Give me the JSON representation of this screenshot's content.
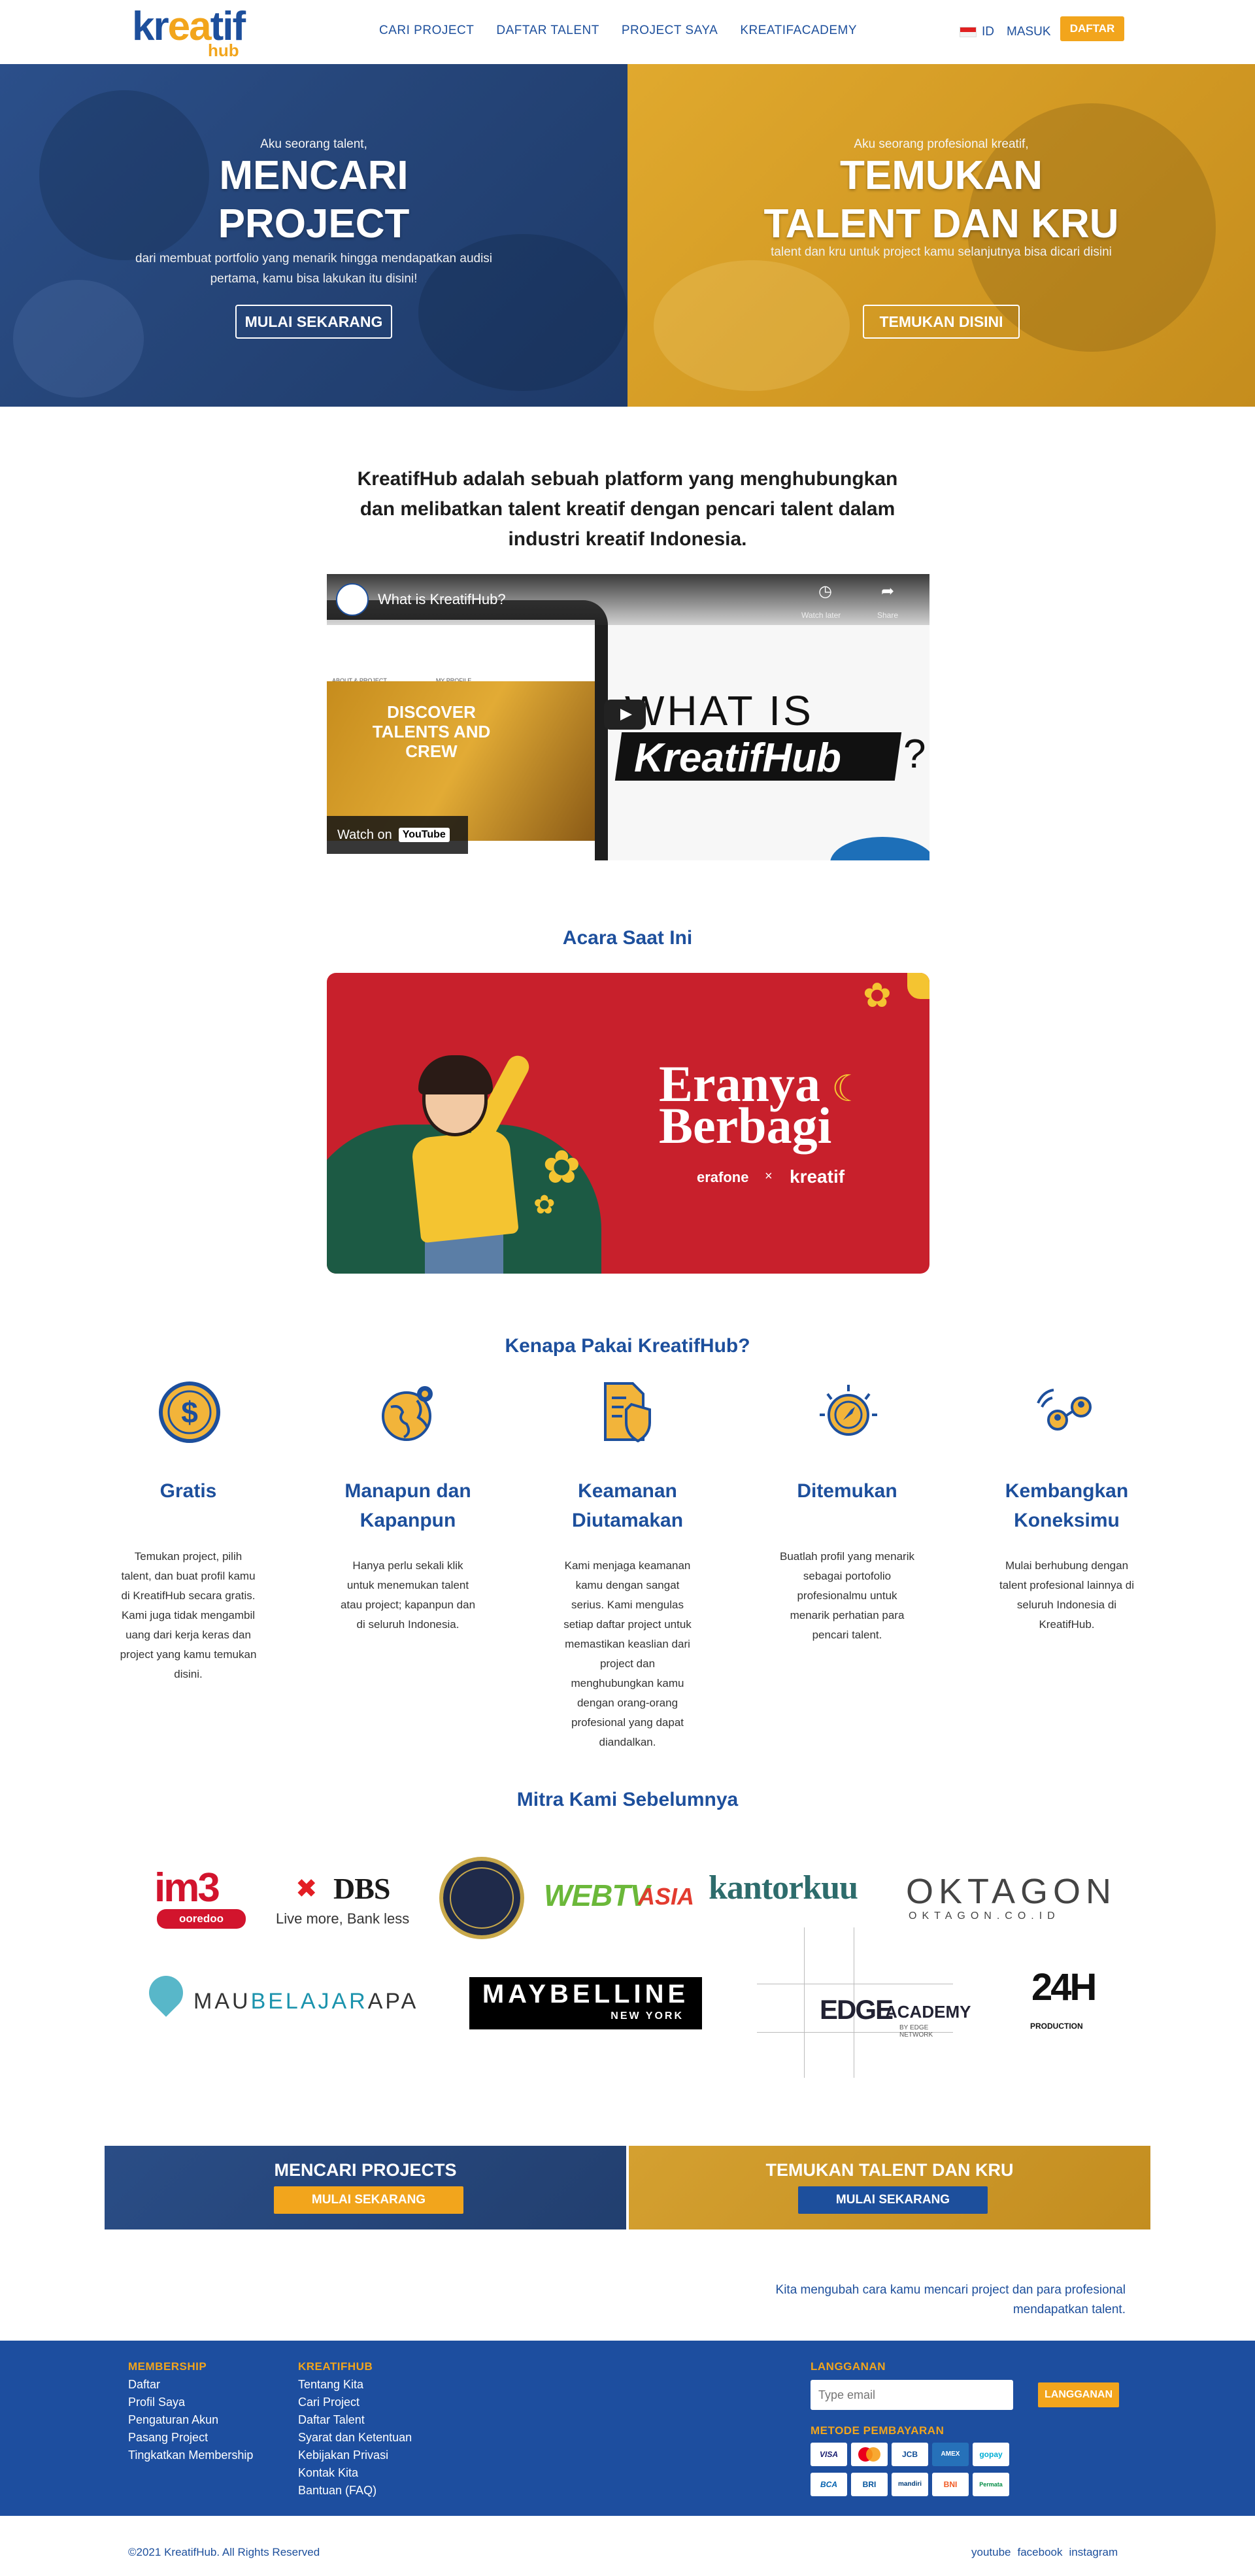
{
  "header": {
    "logo_main_a": "kr",
    "logo_main_b": "ea",
    "logo_main_c": "tif",
    "logo_sub": "hub",
    "nav": [
      "CARI PROJECT",
      "DAFTAR TALENT",
      "PROJECT SAYA",
      "KREATIFACADEMY"
    ],
    "lang": "ID",
    "login": "MASUK",
    "register": "DAFTAR"
  },
  "hero": {
    "left": {
      "pre": "Aku seorang talent,",
      "title_line1": "MENCARI",
      "title_line2": "PROJECT",
      "desc": "dari membuat portfolio yang menarik hingga mendapatkan audisi pertama, kamu bisa lakukan itu disini!",
      "button": "MULAI SEKARANG"
    },
    "right": {
      "pre": "Aku seorang profesional kreatif,",
      "title_line1": "TEMUKAN",
      "title_line2": "TALENT DAN KRU",
      "desc": "talent dan kru untuk project kamu selanjutnya bisa dicari disini",
      "button": "TEMUKAN DISINI"
    }
  },
  "about": {
    "text": "KreatifHub adalah sebuah platform yang menghubungkan dan melibatkan talent kreatif dengan pencari talent dalam industri kreatif Indonesia."
  },
  "video": {
    "title": "What is KreatifHub?",
    "watch_later": "Watch later",
    "share": "Share",
    "watch_on": "Watch on",
    "youtube": "YouTube",
    "headline": "WHAT IS",
    "brand": "KreatifHub",
    "question": "?",
    "tablet_title": "DISCOVER TALENTS AND CREW",
    "tablet_nav": "ABOUT & PROJECT",
    "tablet_menu": "MY PROFILE"
  },
  "events": {
    "heading": "Acara Saat Ini",
    "banner_line1": "Eranya",
    "banner_line2": "Berbagi",
    "partner_a": "erafone",
    "partner_cross": "×",
    "partner_b": "kreatif"
  },
  "why": {
    "heading": "Kenapa Pakai KreatifHub?",
    "items": [
      {
        "icon": "dollar-coin-icon",
        "title": "Gratis",
        "desc": "Temukan project, pilih talent, dan buat profil kamu di KreatifHub secara gratis. Kami juga tidak mengambil uang dari kerja keras dan project yang kamu temukan disini."
      },
      {
        "icon": "globe-location-icon",
        "title": "Manapun dan Kapanpun",
        "desc": "Hanya perlu sekali klik untuk menemukan talent atau project; kapanpun dan di seluruh Indonesia."
      },
      {
        "icon": "secure-document-icon",
        "title": "Keamanan Diutamakan",
        "desc": "Kami menjaga keamanan kamu dengan sangat serius. Kami mengulas setiap daftar project untuk memastikan keaslian dari project dan menghubungkan kamu dengan orang-orang profesional yang dapat diandalkan."
      },
      {
        "icon": "compass-icon",
        "title": "Ditemukan",
        "desc": "Buatlah profil yang menarik sebagai portofolio profesionalmu untuk menarik perhatian para pencari talent."
      },
      {
        "icon": "network-icon",
        "title": "Kembangkan Koneksimu",
        "desc": "Mulai berhubung dengan talent profesional lainnya di seluruh Indonesia di KreatifHub."
      }
    ]
  },
  "partners": {
    "heading": "Mitra Kami Sebelumnya",
    "im3": "im3",
    "im3_sub": "ooredoo",
    "dbs": "DBS",
    "dbs_mark": "✖",
    "dbs_sub": "Live more, Bank less",
    "webtv_a": "WEBTV",
    "webtv_b": "ASIA",
    "kantorkuu": "kantorkuu",
    "oktagon": "OKTAGON",
    "oktagon_sub": "OKTAGON.CO.ID",
    "mau_a": "MAU",
    "mau_b": "BELAJAR",
    "mau_c": "APA",
    "maybelline": "MAYBELLINE",
    "maybelline_sub": "NEW YORK",
    "edge_a": "EDGE",
    "edge_b": "ACADEMY",
    "edge_sub": "BY EDGE NETWORK",
    "h24": "24H",
    "h24_sub": "PRODUCTION"
  },
  "cta": {
    "left_title": "MENCARI PROJECTS",
    "left_button": "MULAI SEKARANG",
    "right_title": "TEMUKAN TALENT DAN KRU",
    "right_button": "MULAI SEKARANG"
  },
  "tagline": "Kita mengubah cara kamu mencari project dan para profesional mendapatkan talent.",
  "footer": {
    "membership_head": "MEMBERSHIP",
    "membership": [
      "Daftar",
      "Profil Saya",
      "Pengaturan Akun",
      "Pasang Project",
      "Tingkatkan Membership"
    ],
    "kreatifhub_head": "KREATIFHUB",
    "kreatifhub": [
      "Tentang Kita",
      "Cari Project",
      "Daftar Talent",
      "Syarat dan Ketentuan",
      "Kebijakan Privasi",
      "Kontak Kita",
      "Bantuan (FAQ)"
    ],
    "subscribe_head": "LANGGANAN",
    "email_placeholder": "Type email",
    "subscribe_button": "LANGGANAN",
    "payment_head": "METODE PEMBAYARAN",
    "payments": [
      "VISA",
      "MC",
      "JCB",
      "AMEX",
      "gopay",
      "BCA",
      "BRI",
      "mandiri",
      "BNI",
      "Permata"
    ]
  },
  "bottom": {
    "copyright": "©2021 KreatifHub. All Rights Reserved",
    "social": [
      "youtube",
      "facebook",
      "instagram"
    ]
  }
}
